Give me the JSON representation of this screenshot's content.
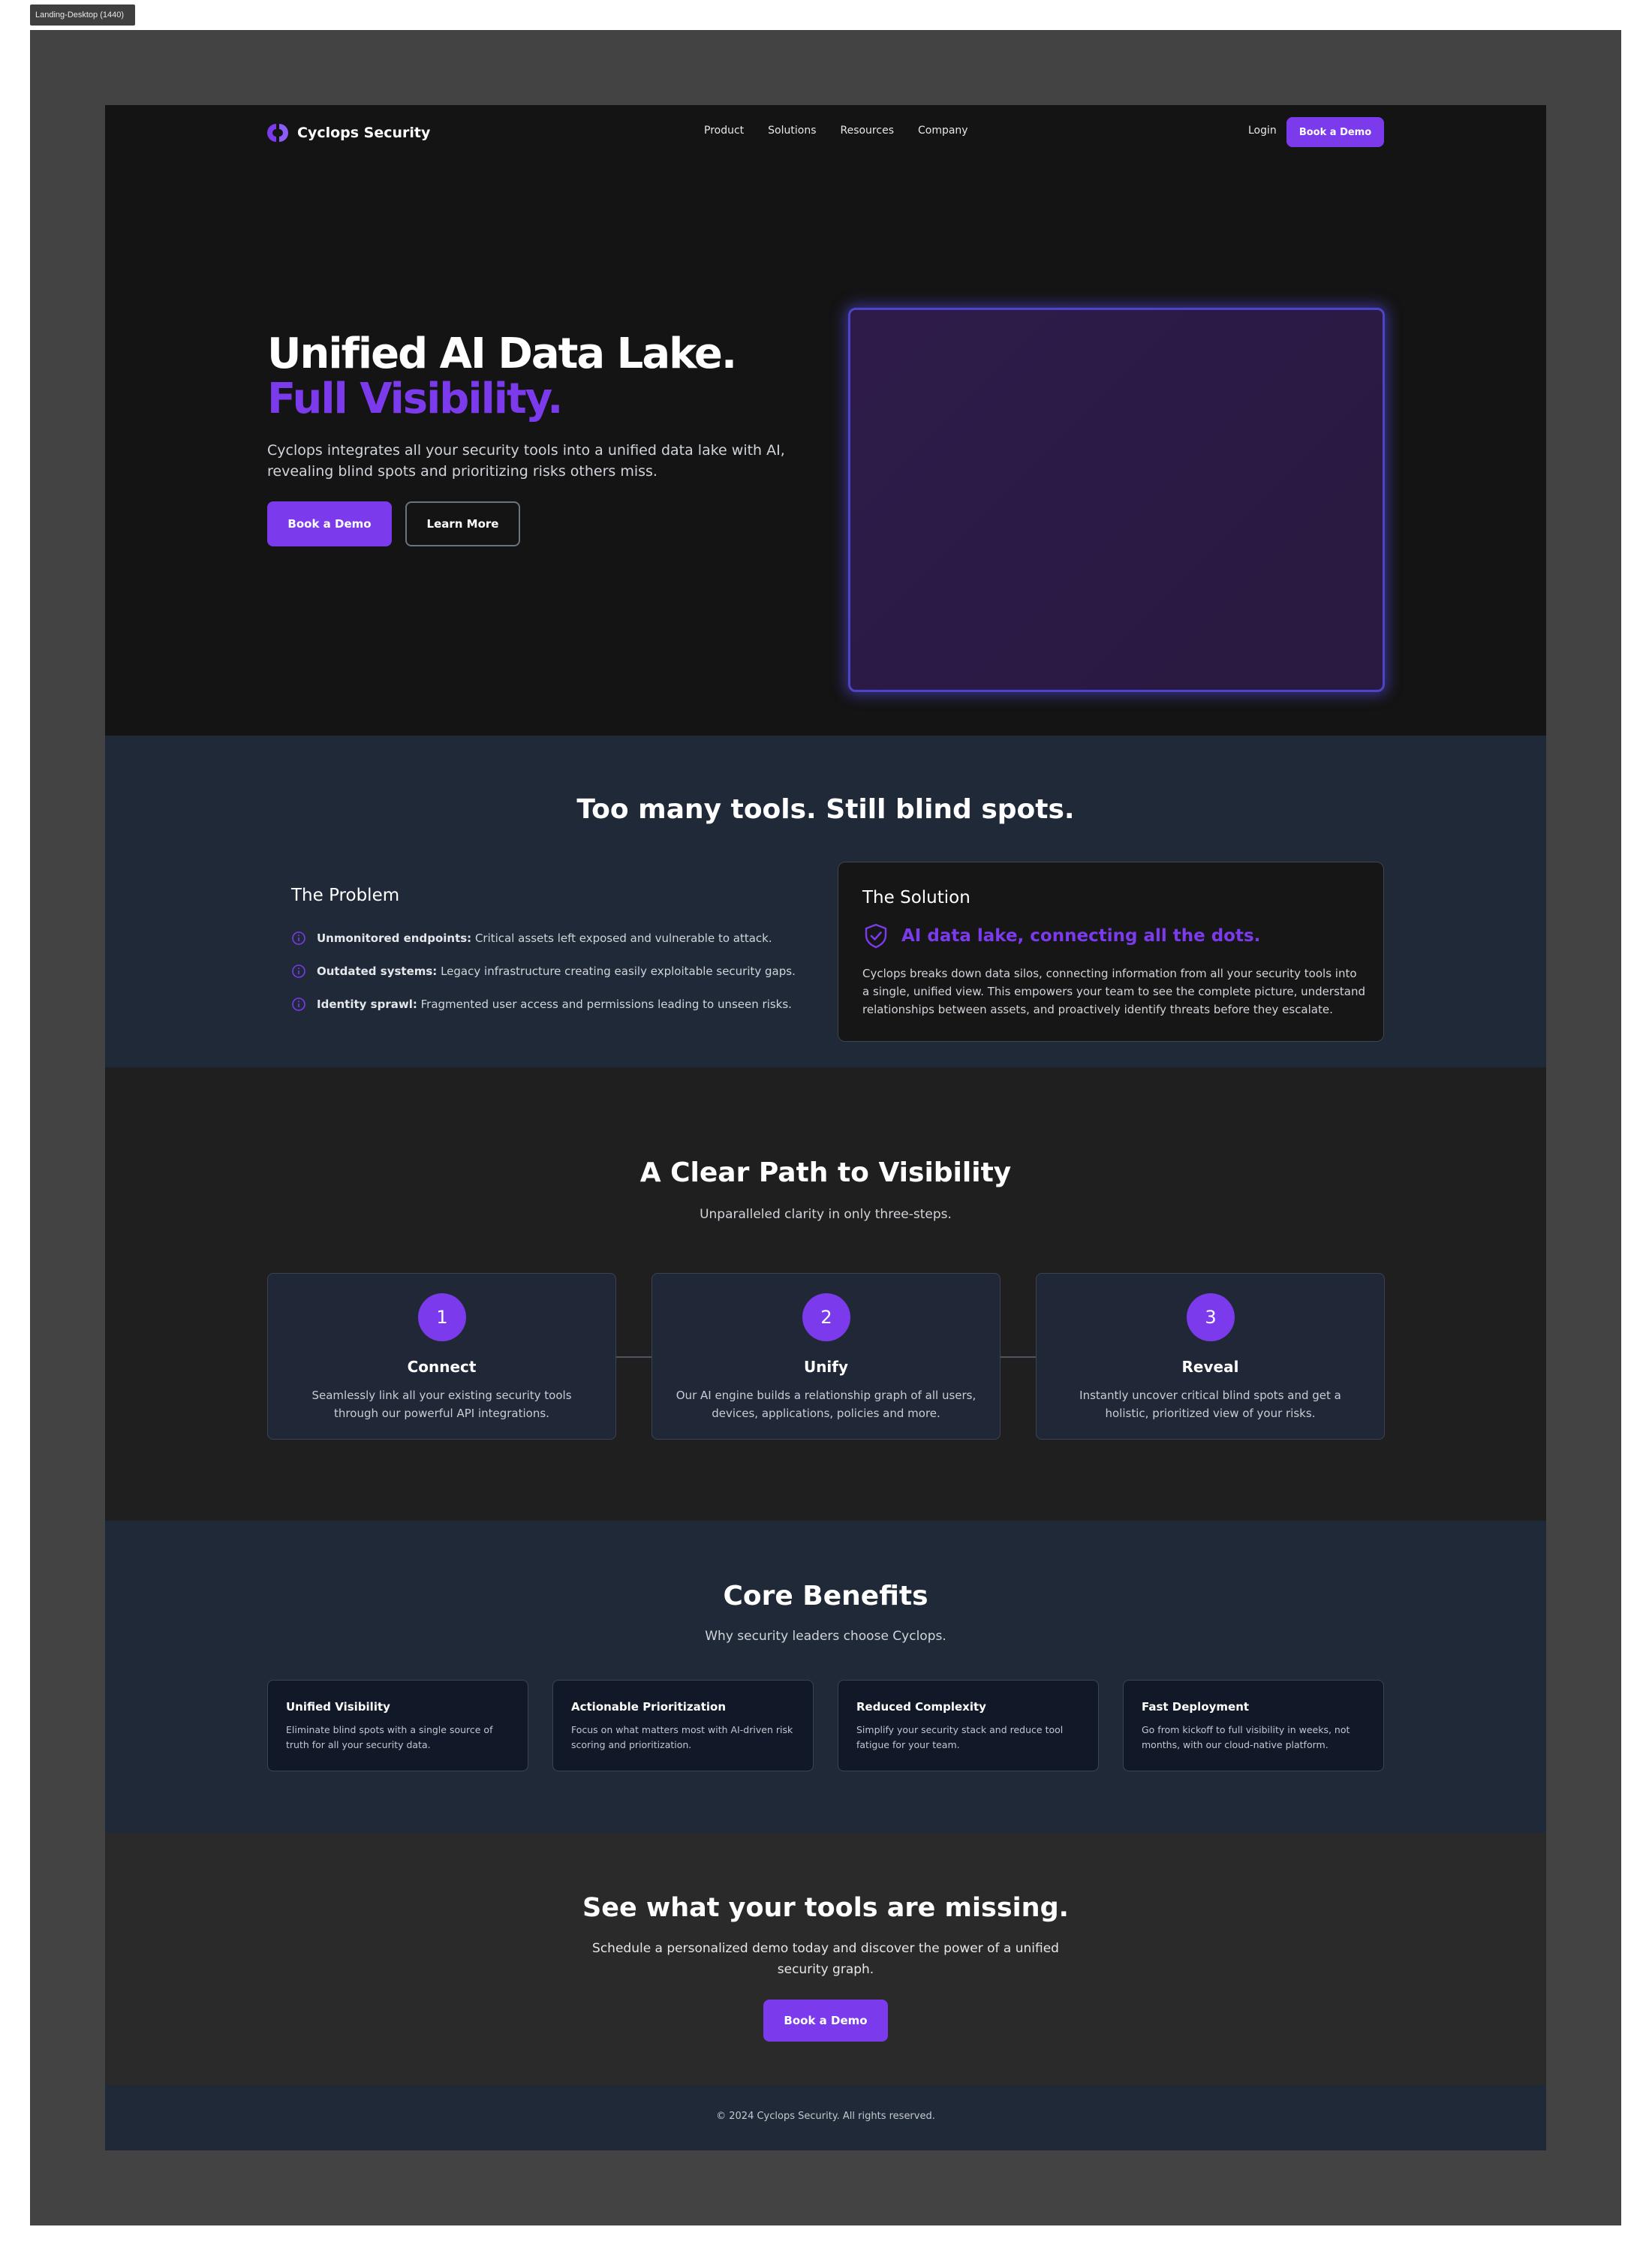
{
  "frame_label": "Landing-Desktop (1440)",
  "colors": {
    "accent": "#7c3aed",
    "hero_bg": "#141414",
    "section_navy": "#1f2937",
    "glow": "#4c45c9"
  },
  "nav": {
    "brand": "Cyclops Security",
    "logo_icon": "cyclops-logo-icon",
    "links": [
      "Product",
      "Solutions",
      "Resources",
      "Company"
    ],
    "login": "Login",
    "cta": "Book a Demo"
  },
  "hero": {
    "title_line1": "Unified AI Data Lake.",
    "title_line2": "Full Visibility.",
    "subtitle": "Cyclops integrates all your security tools into a unified data lake with AI, revealing blind spots and prioritizing risks others miss.",
    "primary_button": "Book a Demo",
    "secondary_button": "Learn More"
  },
  "problem_solution": {
    "title": "Too many tools. Still blind spots.",
    "problem": {
      "title": "The Problem",
      "items": [
        {
          "bold": "Unmonitored endpoints:",
          "text": "Critical assets left exposed and vulnerable to attack.",
          "icon": "info-icon"
        },
        {
          "bold": "Outdated systems:",
          "text": "Legacy infrastructure creating easily exploitable security gaps.",
          "icon": "info-icon"
        },
        {
          "bold": "Identity sprawl:",
          "text": "Fragmented user access and permissions leading to unseen risks.",
          "icon": "info-icon"
        }
      ]
    },
    "solution": {
      "title": "The Solution",
      "headline": "AI data lake, connecting all the dots.",
      "icon": "shield-check-icon",
      "text": "Cyclops breaks down data silos, connecting information from all your security tools into a single, unified view. This empowers your team to see the complete picture, understand relationships between assets, and proactively identify threats before they escalate."
    }
  },
  "path": {
    "title": "A Clear Path to Visibility",
    "subtitle": "Unparalleled clarity in only three-steps.",
    "steps": [
      {
        "number": "1",
        "title": "Connect",
        "text": "Seamlessly link all your existing security tools through our powerful API integrations."
      },
      {
        "number": "2",
        "title": "Unify",
        "text": "Our AI engine builds a relationship graph of all users, devices, applications, policies and more."
      },
      {
        "number": "3",
        "title": "Reveal",
        "text": "Instantly uncover critical blind spots and get a holistic, prioritized view of your risks."
      }
    ]
  },
  "benefits": {
    "title": "Core Benefits",
    "subtitle": "Why security leaders choose Cyclops.",
    "cards": [
      {
        "title": "Unified Visibility",
        "text": "Eliminate blind spots with a single source of truth for all your security data."
      },
      {
        "title": "Actionable Prioritization",
        "text": "Focus on what matters most with AI-driven risk scoring and prioritization."
      },
      {
        "title": "Reduced Complexity",
        "text": "Simplify your security stack and reduce tool fatigue for your team."
      },
      {
        "title": "Fast Deployment",
        "text": "Go from kickoff to full visibility in weeks, not months, with our cloud-native platform."
      }
    ]
  },
  "cta": {
    "title": "See what your tools are missing.",
    "subtitle": "Schedule a personalized demo today and discover the power of a unified security graph.",
    "button": "Book a Demo"
  },
  "footer": {
    "text": "© 2024 Cyclops Security. All rights reserved."
  }
}
